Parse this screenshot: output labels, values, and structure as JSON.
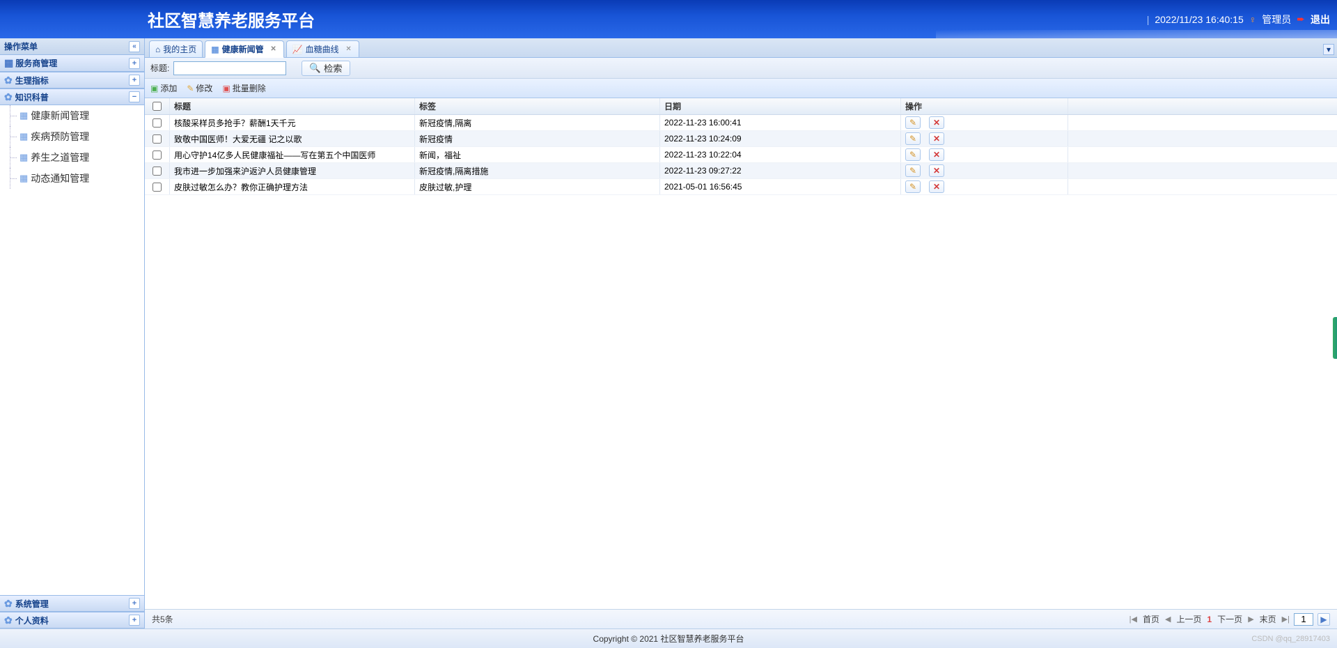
{
  "header": {
    "title": "社区智慧养老服务平台",
    "datetime": "2022/11/23 16:40:15",
    "user_label": "管理员",
    "logout_label": "退出"
  },
  "sidebar": {
    "title": "操作菜单",
    "panels": [
      {
        "label": "服务商管理",
        "expanded": false,
        "icon": "grid"
      },
      {
        "label": "生理指标",
        "expanded": false,
        "icon": "gear"
      },
      {
        "label": "知识科普",
        "expanded": true,
        "icon": "gear"
      },
      {
        "label": "系统管理",
        "expanded": false,
        "icon": "gear"
      },
      {
        "label": "个人资料",
        "expanded": false,
        "icon": "gear"
      }
    ],
    "tree": [
      {
        "label": "健康新闻管理"
      },
      {
        "label": "疾病预防管理"
      },
      {
        "label": "养生之道管理"
      },
      {
        "label": "动态通知管理"
      }
    ]
  },
  "tabs": [
    {
      "label": "我的主页",
      "icon": "home",
      "closable": false
    },
    {
      "label": "健康新闻管",
      "icon": "grid",
      "closable": true,
      "active": true
    },
    {
      "label": "血糖曲线",
      "icon": "chart",
      "closable": true
    }
  ],
  "search": {
    "label": "标题:",
    "value": "",
    "button": "检索"
  },
  "toolbar": {
    "add": "添加",
    "edit": "修改",
    "batch_delete": "批量删除"
  },
  "grid": {
    "columns": {
      "title": "标题",
      "tag": "标签",
      "date": "日期",
      "op": "操作"
    },
    "rows": [
      {
        "title": "核酸采样员多抢手？薪酬1天千元",
        "tag": "新冠疫情,隔离",
        "date": "2022-11-23 16:00:41"
      },
      {
        "title": "致敬中国医师！大爱无疆 记之以歌",
        "tag": "新冠疫情",
        "date": "2022-11-23 10:24:09"
      },
      {
        "title": "用心守护14亿多人民健康福祉——写在第五个中国医师",
        "tag": "新闻，福祉",
        "date": "2022-11-23 10:22:04"
      },
      {
        "title": "我市进一步加强来沪返沪人员健康管理",
        "tag": "新冠疫情,隔离措施",
        "date": "2022-11-23 09:27:22"
      },
      {
        "title": "皮肤过敏怎么办？教你正确护理方法",
        "tag": "皮肤过敏,护理",
        "date": "2021-05-01 16:56:45"
      }
    ]
  },
  "pager": {
    "total": "共5条",
    "first": "首页",
    "prev": "上一页",
    "current": "1",
    "next": "下一页",
    "last": "末页",
    "goto_value": "1"
  },
  "footer": {
    "copyright": "Copyright © 2021 社区智慧养老服务平台",
    "watermark": "CSDN @qq_28917403"
  }
}
